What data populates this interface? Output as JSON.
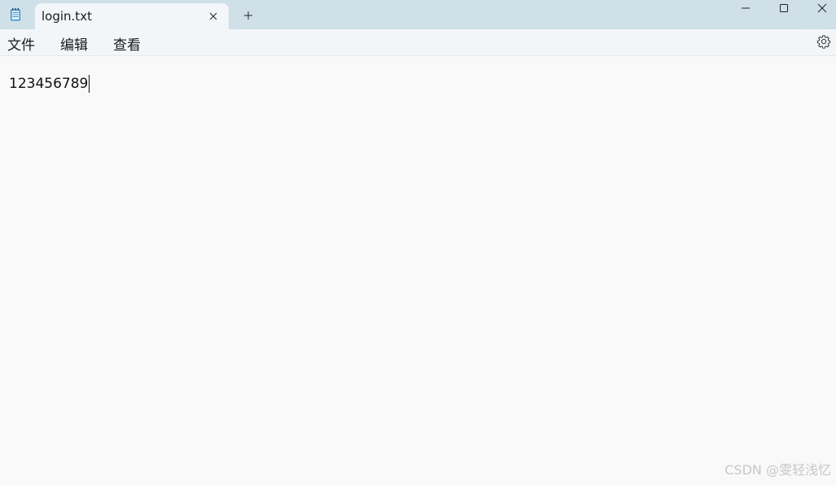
{
  "window": {
    "tab_title": "login.txt",
    "app_icon": "notepad-icon",
    "controls": {
      "minimize_icon": "minimize-icon",
      "maximize_icon": "maximize-icon",
      "close_icon": "close-icon"
    },
    "new_tab_icon": "plus-icon",
    "tab_close_icon": "close-icon"
  },
  "menubar": {
    "items": [
      {
        "label": "文件"
      },
      {
        "label": "编辑"
      },
      {
        "label": "查看"
      }
    ],
    "settings_icon": "gear-icon"
  },
  "editor": {
    "content": "123456789"
  },
  "watermark": "CSDN @雯轻浅忆",
  "colors": {
    "titlebar": "#cfe0e8",
    "tab_active": "#f2f6f8",
    "editor_bg": "#f9f9f9"
  }
}
